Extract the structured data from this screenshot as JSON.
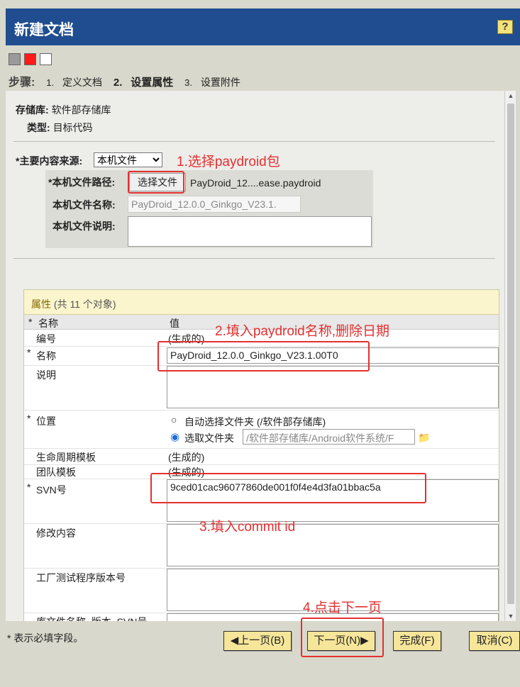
{
  "window": {
    "title": "新建文档",
    "help_label": "?"
  },
  "swatches": [
    {
      "name": "gray",
      "color": "#9a9a9a"
    },
    {
      "name": "red",
      "color": "#ff1a1a"
    },
    {
      "name": "white",
      "color": "#ffffff"
    }
  ],
  "steps": {
    "label": "步骤:",
    "items": [
      {
        "num": "1.",
        "label": "定义文档"
      },
      {
        "num": "2.",
        "label": "设置属性"
      },
      {
        "num": "3.",
        "label": "设置附件"
      }
    ]
  },
  "info": {
    "repo_label": "存储库:",
    "repo_value": "软件部存储库",
    "type_label": "类型:",
    "type_value": "目标代码"
  },
  "source": {
    "label": "*主要内容来源:",
    "selected": "本机文件",
    "path_label": "*本机文件路径:",
    "choose_button": "选择文件",
    "chosen_file": "PayDroid_12....ease.paydroid",
    "name_label": "本机文件名称:",
    "name_value": "PayDroid_12.0.0_Ginkgo_V23.1.",
    "desc_label": "本机文件说明:"
  },
  "attributes": {
    "header_title": "属性",
    "header_count": "(共 11 个对象)",
    "col_star": "*",
    "col_name": "名称",
    "col_value": "值",
    "rows": {
      "number": {
        "name": "编号",
        "value": "(生成的)"
      },
      "name": {
        "name": "名称",
        "value": "PayDroid_12.0.0_Ginkgo_V23.1.00T0"
      },
      "desc": {
        "name": "说明"
      },
      "location": {
        "name": "位置",
        "opt_auto": "自动选择文件夹 (/软件部存储库)",
        "opt_pick": "选取文件夹",
        "folder_value": "/软件部存储库/Android软件系统/F"
      },
      "lifecycle": {
        "name": "生命周期模板",
        "value": "(生成的)"
      },
      "team": {
        "name": "团队模板",
        "value": "(生成的)"
      },
      "svn": {
        "name": "SVN号",
        "value": "9ced01cac96077860de001f0f4e4d3fa01bbac5a"
      },
      "changes": {
        "name": "修改内容"
      },
      "factory": {
        "name": "工厂测试程序版本号"
      },
      "libfile": {
        "name": "库文件名称_版本_SVN号"
      }
    }
  },
  "annotations": {
    "a1": "1.选择paydroid包",
    "a2": "2.填入paydroid名称,删除日期",
    "a3": "3.填入commit id",
    "a4": "4.点击下一页"
  },
  "footer": {
    "required_note": "* 表示必填字段。",
    "prev": "上一页(B)",
    "next": "下一页(N)",
    "finish": "完成(F)",
    "cancel": "取消(C)"
  }
}
